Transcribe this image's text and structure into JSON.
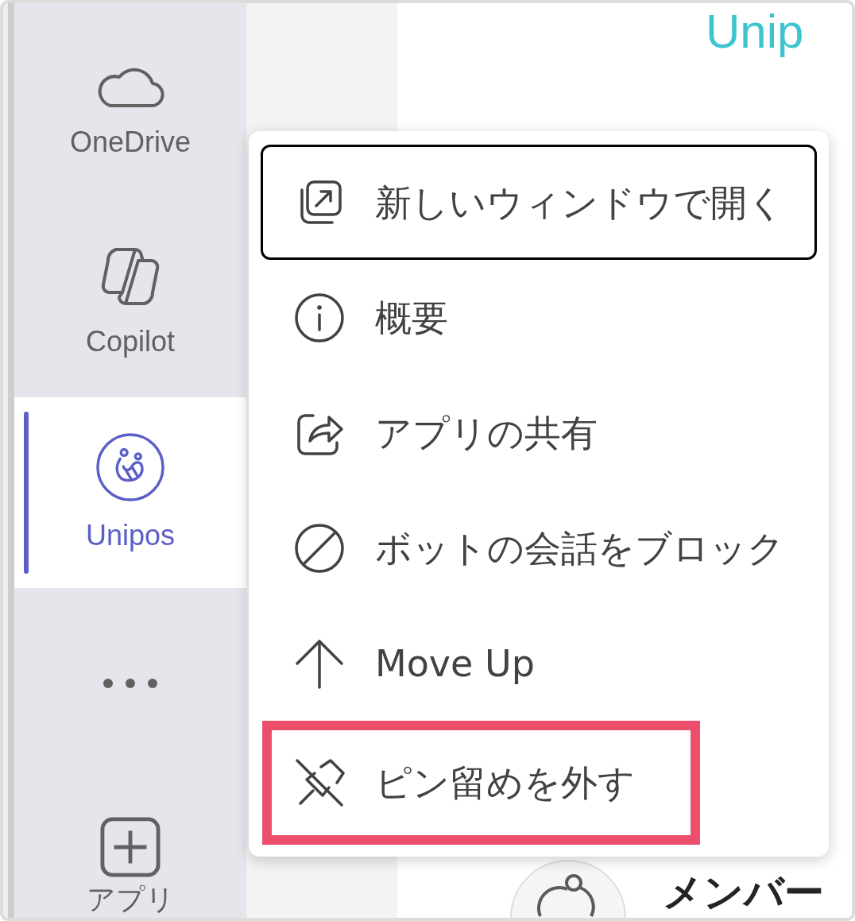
{
  "sidebar": {
    "items": [
      {
        "kind": "cloud",
        "label": "OneDrive",
        "selected": false
      },
      {
        "kind": "copilot",
        "label": "Copilot",
        "selected": false
      },
      {
        "kind": "unipos",
        "label": "Unipos",
        "selected": true
      },
      {
        "kind": "more",
        "selected": false
      },
      {
        "kind": "add",
        "label": "アプリ",
        "selected": false
      }
    ]
  },
  "content": {
    "logo": "Unip",
    "section_title": "メンバー"
  },
  "context_menu": {
    "items": [
      {
        "kind": "popout",
        "label": "新しいウィンドウで開く",
        "focused": true,
        "highlighted": false
      },
      {
        "kind": "info",
        "label": "概要",
        "focused": false,
        "highlighted": false
      },
      {
        "kind": "share",
        "label": "アプリの共有",
        "focused": false,
        "highlighted": false
      },
      {
        "kind": "block",
        "label": "ボットの会話をブロック",
        "focused": false,
        "highlighted": false
      },
      {
        "kind": "up",
        "label": "Move Up",
        "focused": false,
        "highlighted": false
      },
      {
        "kind": "unpin",
        "label": "ピン留めを外す",
        "focused": false,
        "highlighted": true
      }
    ]
  }
}
